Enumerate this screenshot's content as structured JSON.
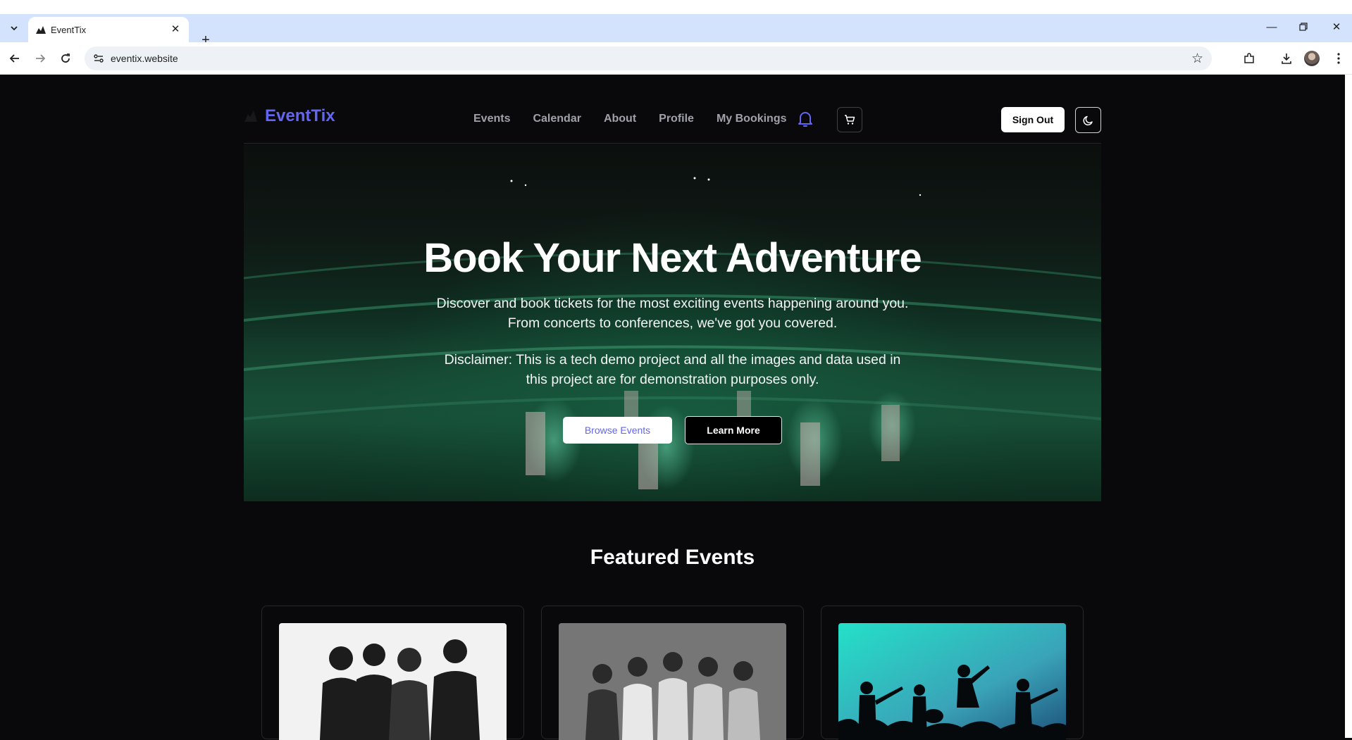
{
  "browser": {
    "tab_title": "EventTix",
    "url": "eventix.website"
  },
  "header": {
    "logo_text": "EventTix",
    "nav": [
      "Events",
      "Calendar",
      "About",
      "Profile",
      "My Bookings"
    ],
    "sign_out": "Sign Out",
    "accent_color": "#6366f1"
  },
  "hero": {
    "title": "Book Your Next Adventure",
    "subtitle": "Discover and book tickets for the most exciting events happening around you. From concerts to conferences, we've got you covered.",
    "disclaimer": "Disclaimer: This is a tech demo project and all the images and data used in this project are for demonstration purposes only.",
    "browse_button": "Browse Events",
    "learn_button": "Learn More"
  },
  "featured": {
    "title": "Featured Events"
  },
  "icons": {
    "tab_list": "chevron-down-icon",
    "favicon": "logo-icon",
    "notifications": "bell-icon",
    "cart": "cart-icon",
    "theme": "moon-icon"
  }
}
